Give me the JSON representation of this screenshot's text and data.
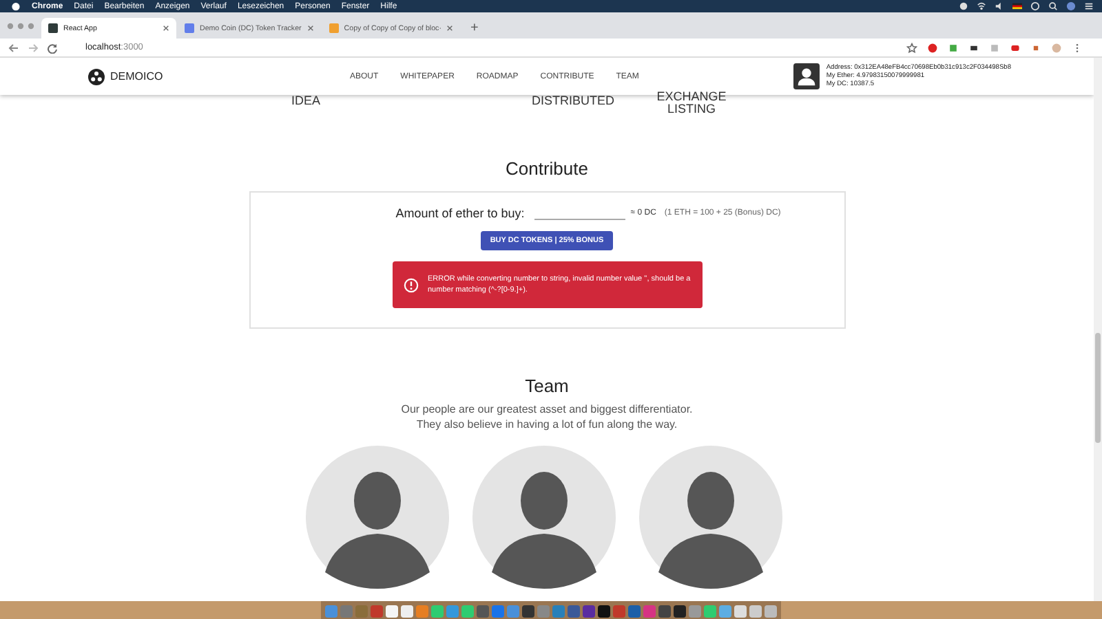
{
  "menu_bar": {
    "app": "Chrome",
    "items": [
      "Datei",
      "Bearbeiten",
      "Anzeigen",
      "Verlauf",
      "Lesezeichen",
      "Personen",
      "Fenster",
      "Hilfe"
    ]
  },
  "browser": {
    "tabs": [
      {
        "title": "React App",
        "selected": true
      },
      {
        "title": "Demo Coin (DC) Token Tracker",
        "selected": false
      },
      {
        "title": "Copy of Copy of Copy of bloc·",
        "selected": false
      }
    ],
    "new_tab": "+",
    "url_host": "localhost",
    "url_port": ":3000"
  },
  "header": {
    "logo": "DEMOICO",
    "nav": [
      "ABOUT",
      "WHITEPAPER",
      "ROADMAP",
      "CONTRIBUTE",
      "TEAM"
    ],
    "account": {
      "address": "Address: 0x312EA48eFB4cc70698Eb0b31c913c2F034498Sb8",
      "ether": "My Ether: 4.97983150079999981",
      "dc": "My DC: 10387.5"
    }
  },
  "roadmap": [
    {
      "lines": [
        "IDEA"
      ]
    },
    {
      "lines": [
        "DISTRIBUTED"
      ]
    },
    {
      "lines": [
        "EXCHANGE",
        "LISTING"
      ]
    }
  ],
  "contribute": {
    "title": "Contribute",
    "label": "Amount of ether to buy:",
    "estimate": "≈ 0 DC",
    "rate": "(1 ETH = 100 + 25 (Bonus) DC)",
    "button": "BUY DC TOKENS | 25% BONUS",
    "error": "ERROR while converting number to string, invalid number value '', should be a number matching (^-?[0-9.]+)."
  },
  "team": {
    "title": "Team",
    "lines": [
      "Our people are our greatest asset and biggest differentiator.",
      "They also believe in having a lot of fun along the way."
    ],
    "members": [
      {
        "kind": "avatar"
      },
      {
        "kind": "avatar"
      },
      {
        "kind": "avatar"
      }
    ]
  }
}
